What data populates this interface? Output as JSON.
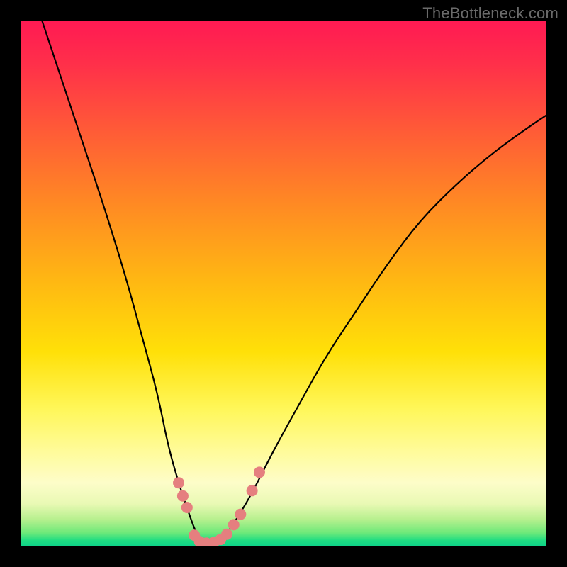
{
  "watermark": "TheBottleneck.com",
  "colors": {
    "frame_bg": "#000000",
    "curve_stroke": "#000000",
    "dot_fill": "#e57f7f",
    "gradient_stops": [
      "#ff1a53",
      "#ff2f4a",
      "#ff5838",
      "#ff8a23",
      "#ffb912",
      "#ffe008",
      "#fff75a",
      "#fffb9a",
      "#fdfdc9",
      "#e9f9b4",
      "#b6f08e",
      "#6fe97a",
      "#1fdd82",
      "#0fd488"
    ]
  },
  "chart_data": {
    "type": "line",
    "title": "",
    "xlabel": "",
    "ylabel": "",
    "xlim": [
      0,
      100
    ],
    "ylim": [
      0,
      100
    ],
    "grid": false,
    "legend": false,
    "annotations": [],
    "series": [
      {
        "name": "bottleneck-curve",
        "x": [
          4,
          8,
          12,
          16,
          20,
          23,
          26,
          28,
          30,
          32,
          33.5,
          35,
          37,
          39,
          41,
          44,
          48,
          53,
          58,
          64,
          70,
          76,
          83,
          90,
          97,
          100
        ],
        "y": [
          100,
          88,
          76,
          64,
          51,
          40,
          29,
          19,
          12,
          6,
          2,
          0.5,
          0.5,
          2,
          5,
          10,
          18,
          27,
          36,
          45,
          54,
          62,
          69,
          75,
          80,
          82
        ]
      }
    ],
    "highlight_points": {
      "name": "dots-near-minimum",
      "points": [
        {
          "x": 30.0,
          "y": 12.0
        },
        {
          "x": 30.8,
          "y": 9.5
        },
        {
          "x": 31.6,
          "y": 7.3
        },
        {
          "x": 33.0,
          "y": 2.0
        },
        {
          "x": 34.0,
          "y": 0.8
        },
        {
          "x": 35.3,
          "y": 0.5
        },
        {
          "x": 36.7,
          "y": 0.6
        },
        {
          "x": 38.0,
          "y": 1.2
        },
        {
          "x": 39.2,
          "y": 2.2
        },
        {
          "x": 40.5,
          "y": 4.0
        },
        {
          "x": 41.8,
          "y": 6.0
        },
        {
          "x": 44.0,
          "y": 10.5
        },
        {
          "x": 45.4,
          "y": 14.0
        }
      ]
    }
  }
}
